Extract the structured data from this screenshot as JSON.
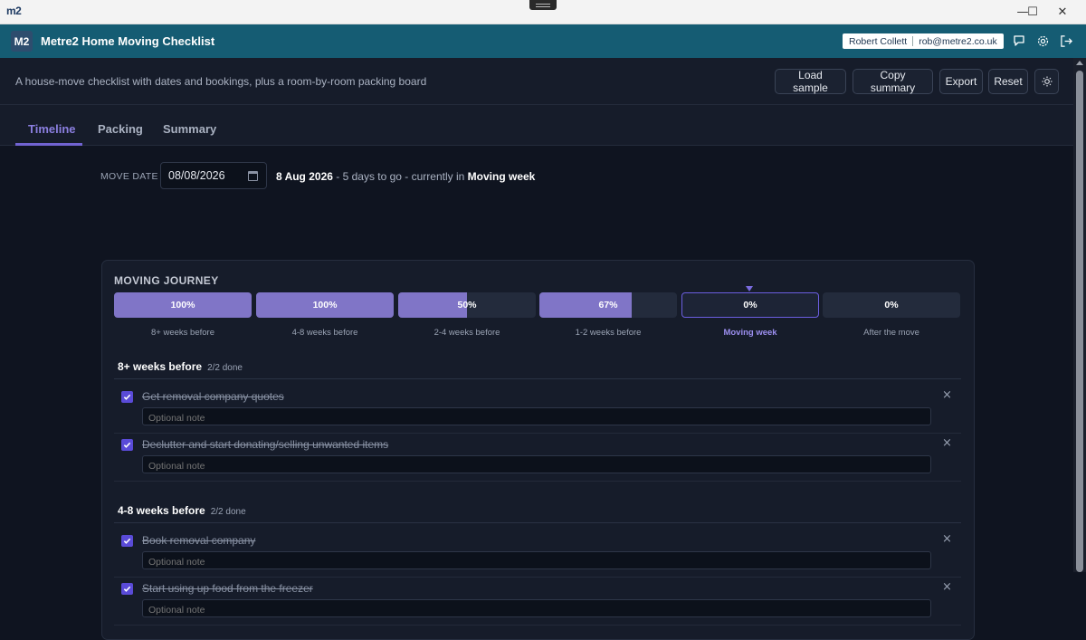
{
  "window": {
    "logo": "m2",
    "controls": [
      "—",
      "☐",
      "✕"
    ]
  },
  "header": {
    "badge": "M2",
    "title": "Metre2 Home Moving Checklist",
    "user_name": "Robert Collett",
    "user_email": "rob@metre2.co.uk",
    "icons": [
      "chat-icon",
      "settings-icon",
      "logout-icon"
    ]
  },
  "toolbar": {
    "description": "A house-move checklist with dates and bookings, plus a room-by-room packing board",
    "buttons": [
      "Load sample",
      "Copy summary",
      "Export",
      "Reset"
    ],
    "theme_icon": "sun-icon"
  },
  "tabs": [
    "Timeline",
    "Packing",
    "Summary"
  ],
  "active_tab": "Timeline",
  "move": {
    "label": "MOVE DATE",
    "date_value": "08/08/2026",
    "date_long": "8 Aug 2026",
    "days_text": " - 5 days to go - currently in ",
    "current_stage": "Moving week"
  },
  "journey": {
    "title": "MOVING JOURNEY",
    "stages": [
      {
        "label": "8+ weeks before",
        "pct_text": "100%",
        "progress": 1.0
      },
      {
        "label": "4-8 weeks before",
        "pct_text": "100%",
        "progress": 1.0
      },
      {
        "label": "2-4 weeks before",
        "pct_text": "50%",
        "progress": 0.5
      },
      {
        "label": "1-2 weeks before",
        "pct_text": "67%",
        "progress": 0.67
      },
      {
        "label": "Moving week",
        "pct_text": "0%",
        "progress": 0
      },
      {
        "label": "After the move",
        "pct_text": "0%",
        "progress": 0
      }
    ]
  },
  "groups": [
    {
      "title": "8+ weeks before",
      "count": "2/2 done",
      "tasks": [
        {
          "title": "Get removal company quotes",
          "done": true,
          "note_placeholder": "Optional note"
        },
        {
          "title": "Declutter and start donating/selling unwanted items",
          "done": true,
          "note_placeholder": "Optional note"
        }
      ]
    },
    {
      "title": "4-8 weeks before",
      "count": "2/2 done",
      "tasks": [
        {
          "title": "Book removal company",
          "done": true,
          "note_placeholder": "Optional note"
        },
        {
          "title": "Start using up food from the freezer",
          "done": true,
          "note_placeholder": "Optional note"
        }
      ]
    }
  ],
  "colors": {
    "header_bg": "#155c73",
    "accent": "#7163d1",
    "stage_fill": "#8075c7",
    "checkbox": "#5a4bd8"
  }
}
